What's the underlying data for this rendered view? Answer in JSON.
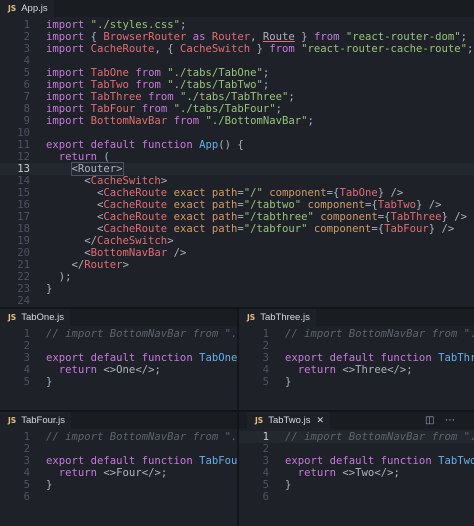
{
  "panes": {
    "app": {
      "tab": "App.js",
      "lines": [
        [
          [
            "kw",
            "import "
          ],
          [
            "str",
            "\"./styles.css\""
          ],
          [
            "pl",
            ";"
          ]
        ],
        [
          [
            "kw",
            "import "
          ],
          [
            "pl",
            "{ "
          ],
          [
            "id",
            "BrowserRouter"
          ],
          [
            "kw",
            " as "
          ],
          [
            "id",
            "Router"
          ],
          [
            "pl",
            ", "
          ],
          [
            "und",
            "Route"
          ],
          [
            "pl",
            " } "
          ],
          [
            "kw",
            "from "
          ],
          [
            "str",
            "\"react-router-dom\""
          ],
          [
            "pl",
            ";"
          ]
        ],
        [
          [
            "kw",
            "import "
          ],
          [
            "id",
            "CacheRoute"
          ],
          [
            "pl",
            ", { "
          ],
          [
            "id",
            "CacheSwitch"
          ],
          [
            "pl",
            " } "
          ],
          [
            "kw",
            "from "
          ],
          [
            "str",
            "\"react-router-cache-route\""
          ],
          [
            "pl",
            ";"
          ]
        ],
        [],
        [
          [
            "kw",
            "import "
          ],
          [
            "id",
            "TabOne"
          ],
          [
            "kw",
            " from "
          ],
          [
            "str",
            "\"./tabs/TabOne\""
          ],
          [
            "pl",
            ";"
          ]
        ],
        [
          [
            "kw",
            "import "
          ],
          [
            "id",
            "TabTwo"
          ],
          [
            "kw",
            " from "
          ],
          [
            "str",
            "\"./tabs/TabTwo\""
          ],
          [
            "pl",
            ";"
          ]
        ],
        [
          [
            "kw",
            "import "
          ],
          [
            "id",
            "TabThree"
          ],
          [
            "kw",
            " from "
          ],
          [
            "str",
            "\"./tabs/TabThree\""
          ],
          [
            "pl",
            ";"
          ]
        ],
        [
          [
            "kw",
            "import "
          ],
          [
            "id",
            "TabFour"
          ],
          [
            "kw",
            " from "
          ],
          [
            "str",
            "\"./tabs/TabFour\""
          ],
          [
            "pl",
            ";"
          ]
        ],
        [
          [
            "kw",
            "import "
          ],
          [
            "id",
            "BottomNavBar"
          ],
          [
            "kw",
            " from "
          ],
          [
            "str",
            "\"./BottomNavBar\""
          ],
          [
            "pl",
            ";"
          ]
        ],
        [],
        [
          [
            "kw",
            "export default function "
          ],
          [
            "fn",
            "App"
          ],
          [
            "pl",
            "() {"
          ]
        ],
        [
          [
            "pl",
            "  "
          ],
          [
            "kw",
            "return"
          ],
          [
            "pl",
            " ("
          ]
        ],
        [
          [
            "pl",
            "    "
          ],
          [
            "box",
            "<Router>"
          ]
        ],
        [
          [
            "pl",
            "      <"
          ],
          [
            "id",
            "CacheSwitch"
          ],
          [
            "pl",
            ">"
          ]
        ],
        [
          [
            "pl",
            "        <"
          ],
          [
            "id",
            "CacheRoute"
          ],
          [
            "at",
            " exact path"
          ],
          [
            "pl",
            "="
          ],
          [
            "str",
            "\"/\""
          ],
          [
            "at",
            " component"
          ],
          [
            "pl",
            "={"
          ],
          [
            "id",
            "TabOne"
          ],
          [
            "pl",
            "} />"
          ]
        ],
        [
          [
            "pl",
            "        <"
          ],
          [
            "id",
            "CacheRoute"
          ],
          [
            "at",
            " exact path"
          ],
          [
            "pl",
            "="
          ],
          [
            "str",
            "\"/tabtwo\""
          ],
          [
            "at",
            " component"
          ],
          [
            "pl",
            "={"
          ],
          [
            "id",
            "TabTwo"
          ],
          [
            "pl",
            "} />"
          ]
        ],
        [
          [
            "pl",
            "        <"
          ],
          [
            "id",
            "CacheRoute"
          ],
          [
            "at",
            " exact path"
          ],
          [
            "pl",
            "="
          ],
          [
            "str",
            "\"/tabthree\""
          ],
          [
            "at",
            " component"
          ],
          [
            "pl",
            "={"
          ],
          [
            "id",
            "TabThree"
          ],
          [
            "pl",
            "} />"
          ]
        ],
        [
          [
            "pl",
            "        <"
          ],
          [
            "id",
            "CacheRoute"
          ],
          [
            "at",
            " exact path"
          ],
          [
            "pl",
            "="
          ],
          [
            "str",
            "\"/tabfour\""
          ],
          [
            "at",
            " component"
          ],
          [
            "pl",
            "={"
          ],
          [
            "id",
            "TabFour"
          ],
          [
            "pl",
            "} />"
          ]
        ],
        [
          [
            "pl",
            "      </"
          ],
          [
            "id",
            "CacheSwitch"
          ],
          [
            "pl",
            ">"
          ]
        ],
        [
          [
            "pl",
            "      <"
          ],
          [
            "id",
            "BottomNavBar"
          ],
          [
            "pl",
            " />"
          ]
        ],
        [
          [
            "pl",
            "    </"
          ],
          [
            "id",
            "Router"
          ],
          [
            "pl",
            ">"
          ]
        ],
        [
          [
            "pl",
            "  );"
          ]
        ],
        [
          [
            "pl",
            "}"
          ]
        ],
        []
      ]
    },
    "tabone": {
      "tab": "TabOne.js",
      "lines": [
        [
          [
            "cm",
            "// import BottomNavBar from \"../Bo"
          ]
        ],
        [],
        [
          [
            "kw",
            "export default function "
          ],
          [
            "fn",
            "TabOne"
          ],
          [
            "pl",
            "() {"
          ]
        ],
        [
          [
            "pl",
            "  "
          ],
          [
            "kw",
            "return"
          ],
          [
            "pl",
            " <>One</>;"
          ]
        ],
        [
          [
            "pl",
            "}"
          ]
        ]
      ]
    },
    "tabthree": {
      "tab": "TabThree.js",
      "lines": [
        [
          [
            "cm",
            "// import BottomNavBar from \"../Bo"
          ]
        ],
        [],
        [
          [
            "kw",
            "export default function "
          ],
          [
            "fn",
            "TabThree"
          ],
          [
            "pl",
            "()"
          ]
        ],
        [
          [
            "pl",
            "  "
          ],
          [
            "kw",
            "return"
          ],
          [
            "pl",
            " <>Three</>;"
          ]
        ],
        [
          [
            "pl",
            "}"
          ]
        ]
      ]
    },
    "tabfour": {
      "tab": "TabFour.js",
      "lines": [
        [
          [
            "cm",
            "// import BottomNavBar from \"../Bo"
          ]
        ],
        [],
        [
          [
            "kw",
            "export default function "
          ],
          [
            "fn",
            "TabFour"
          ],
          [
            "pl",
            "()"
          ]
        ],
        [
          [
            "pl",
            "  "
          ],
          [
            "kw",
            "return"
          ],
          [
            "pl",
            " <>Four</>;"
          ]
        ],
        [
          [
            "pl",
            "}"
          ]
        ],
        []
      ]
    },
    "tabtwo": {
      "tab": "TabTwo.js",
      "lines": [
        [
          [
            "cm",
            "// import BottomNavBar from \"../Bo"
          ]
        ],
        [],
        [
          [
            "kw",
            "export default function "
          ],
          [
            "fn",
            "TabTwo"
          ],
          [
            "pl",
            "()"
          ]
        ],
        [
          [
            "pl",
            "  "
          ],
          [
            "kw",
            "return"
          ],
          [
            "pl",
            " <>Two</>;"
          ]
        ],
        [
          [
            "pl",
            "}"
          ]
        ],
        []
      ]
    }
  },
  "current_line": 13,
  "icons": {
    "js": "JS",
    "split": "split-editor-icon",
    "more": "more-icon",
    "close": "close-icon"
  },
  "colors": {
    "keyword": "#c678dd",
    "identifier": "#e06c75",
    "string": "#98c379",
    "function": "#61afef",
    "comment": "#5c6370"
  }
}
